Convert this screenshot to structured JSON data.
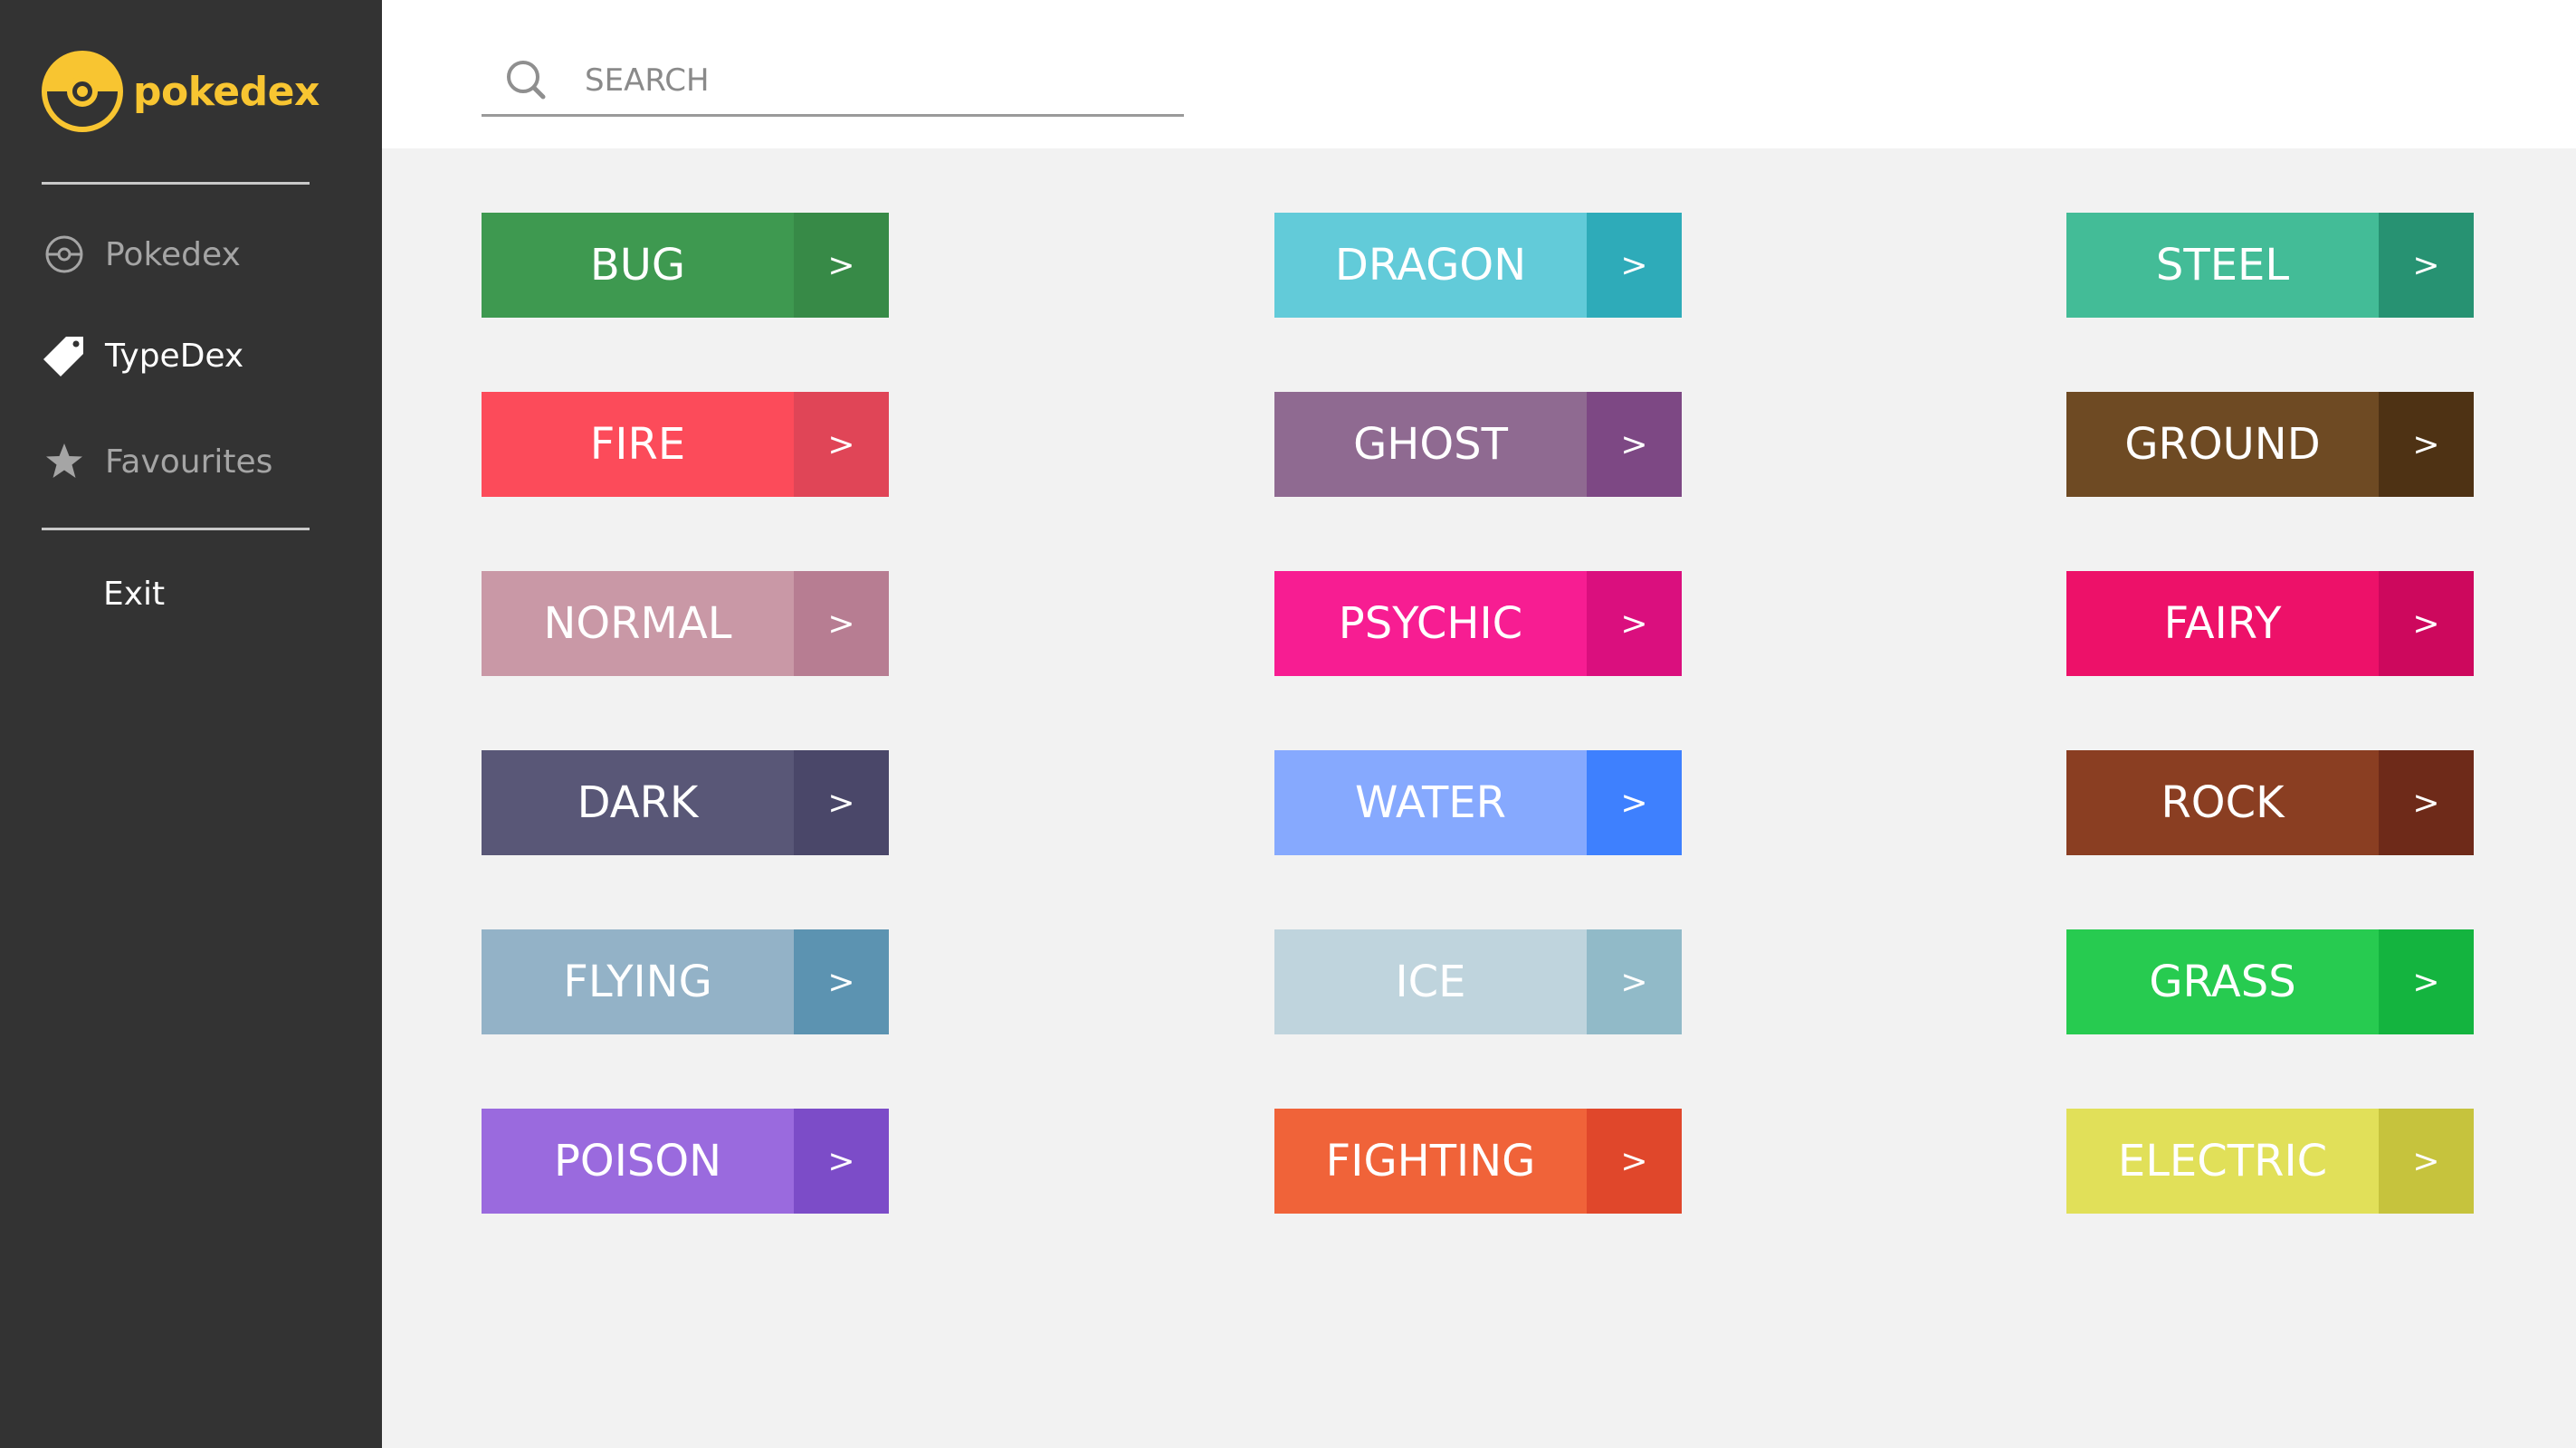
{
  "brand": {
    "name": "pokedex",
    "logo_icon": "pokeball-icon",
    "color": "#f8c531"
  },
  "sidebar": {
    "items": [
      {
        "label": "Pokedex",
        "icon": "pokeball-outline-icon",
        "active": false
      },
      {
        "label": "TypeDex",
        "icon": "tag-icon",
        "active": true
      },
      {
        "label": "Favourites",
        "icon": "star-icon",
        "active": false
      }
    ],
    "exit_label": "Exit"
  },
  "search": {
    "placeholder": "SEARCH",
    "value": ""
  },
  "types": [
    {
      "name": "BUG",
      "arrow": ">",
      "color": "#3e9950",
      "dark": "#378a47"
    },
    {
      "name": "FIRE",
      "arrow": ">",
      "color": "#fc4b5a",
      "dark": "#e04557"
    },
    {
      "name": "NORMAL",
      "arrow": ">",
      "color": "#c998a6",
      "dark": "#b77d92"
    },
    {
      "name": "DARK",
      "arrow": ">",
      "color": "#595777",
      "dark": "#4a4769"
    },
    {
      "name": "FLYING",
      "arrow": ">",
      "color": "#93b2c7",
      "dark": "#5c93b1"
    },
    {
      "name": "POISON",
      "arrow": ">",
      "color": "#9a6ade",
      "dark": "#7c4cc8"
    },
    {
      "name": "DRAGON",
      "arrow": ">",
      "color": "#62cbd9",
      "dark": "#2eabb9"
    },
    {
      "name": "GHOST",
      "arrow": ">",
      "color": "#8f6a91",
      "dark": "#7d4884"
    },
    {
      "name": "PSYCHIC",
      "arrow": ">",
      "color": "#f71d92",
      "dark": "#da0f7e"
    },
    {
      "name": "WATER",
      "arrow": ">",
      "color": "#86a9fe",
      "dark": "#3e80fe"
    },
    {
      "name": "ICE",
      "arrow": ">",
      "color": "#bfd4dd",
      "dark": "#91bac8"
    },
    {
      "name": "FIGHTING",
      "arrow": ">",
      "color": "#f06339",
      "dark": "#e0472b"
    },
    {
      "name": "STEEL",
      "arrow": ">",
      "color": "#43bc97",
      "dark": "#279272"
    },
    {
      "name": "GROUND",
      "arrow": ">",
      "color": "#6e4a23",
      "dark": "#4e3214"
    },
    {
      "name": "FAIRY",
      "arrow": ">",
      "color": "#ed1169",
      "dark": "#cd085d"
    },
    {
      "name": "ROCK",
      "arrow": ">",
      "color": "#8a3e22",
      "dark": "#6e2a19"
    },
    {
      "name": "GRASS",
      "arrow": ">",
      "color": "#27cb50",
      "dark": "#14b43f"
    },
    {
      "name": "ELECTRIC",
      "arrow": ">",
      "color": "#e1e059",
      "dark": "#c6c33d"
    }
  ]
}
